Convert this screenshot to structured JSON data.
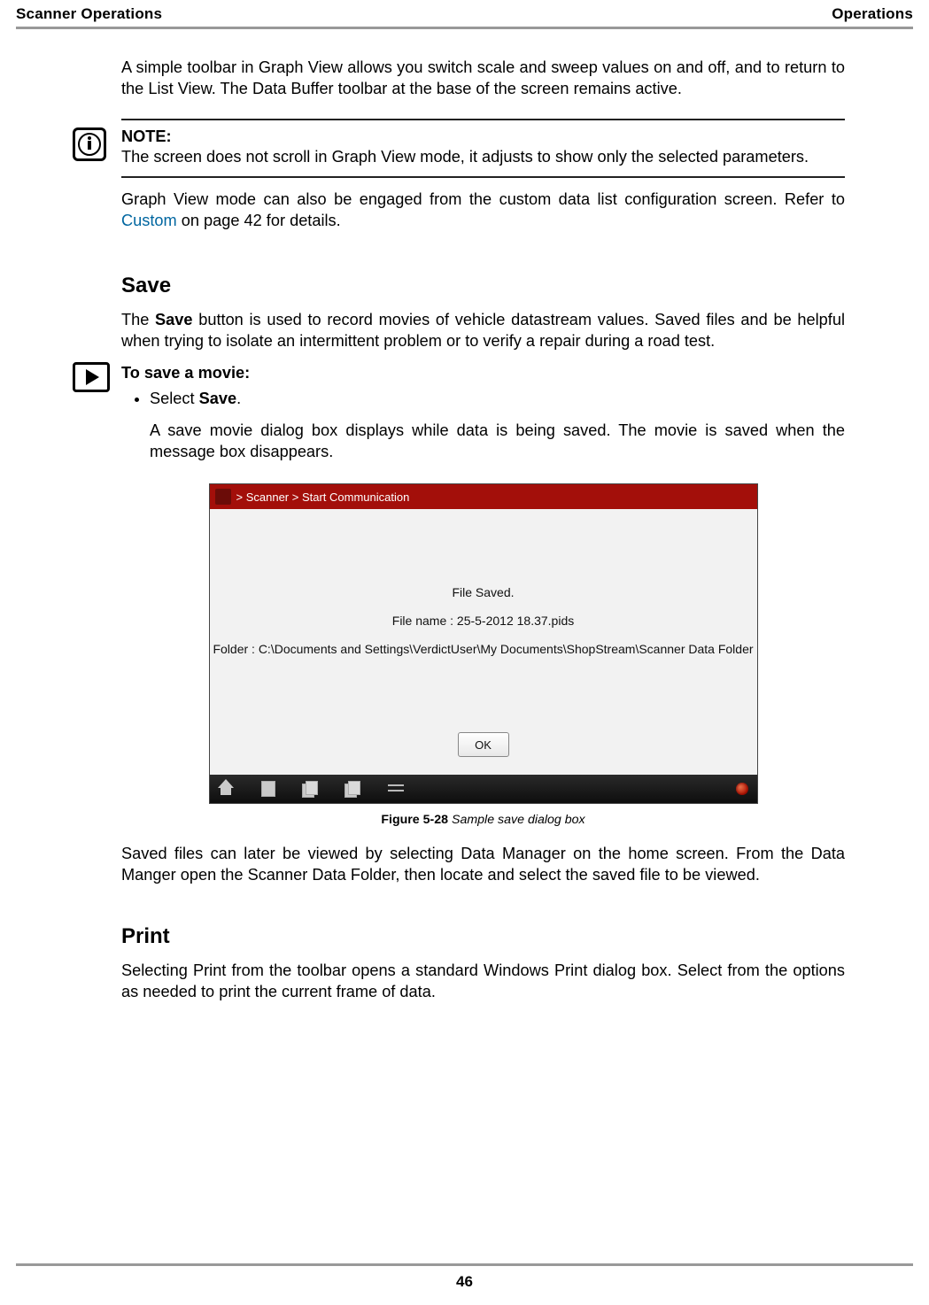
{
  "header": {
    "left": "Scanner Operations",
    "right": "Operations"
  },
  "intro_para": "A simple toolbar in Graph View allows you switch scale and sweep values on and off, and to return to the List View. The Data Buffer toolbar at the base of the screen remains active.",
  "note": {
    "label": "NOTE:",
    "text": "The screen does not scroll in Graph View mode, it adjusts to show only the selected parameters."
  },
  "after_note_para_prefix": "Graph View mode can also be engaged from the custom data list configuration screen. Refer to ",
  "after_note_link": "Custom",
  "after_note_para_suffix": " on page 42 for details.",
  "save": {
    "heading": "Save",
    "para_prefix": "The ",
    "para_bold": "Save",
    "para_suffix": " button is used to record movies of vehicle datastream values. Saved files and be helpful when trying to isolate an intermittent problem or to verify a repair during a road test.",
    "procedure_title": "To save a movie:",
    "step_prefix": "Select ",
    "step_bold": "Save",
    "step_suffix": ".",
    "step_desc": "A save movie dialog box displays while data is being saved. The movie is saved when the message box disappears."
  },
  "screenshot": {
    "breadcrumb": "> Scanner  > Start Communication",
    "line1": "File Saved.",
    "line2": "File name : 25-5-2012 18.37.pids",
    "line3": "Folder : C:\\Documents and Settings\\VerdictUser\\My Documents\\ShopStream\\Scanner Data Folder",
    "ok": "OK"
  },
  "figure": {
    "number": "Figure 5-28",
    "caption": " Sample save dialog box"
  },
  "after_figure_para": "Saved files can later be viewed by selecting Data Manager on the home screen. From the Data Manger open the Scanner Data Folder, then locate and select the saved file to be viewed.",
  "print": {
    "heading": "Print",
    "para": "Selecting Print from the toolbar opens a standard Windows Print dialog box. Select from the options as needed to print the current frame of data."
  },
  "page_number": "46"
}
